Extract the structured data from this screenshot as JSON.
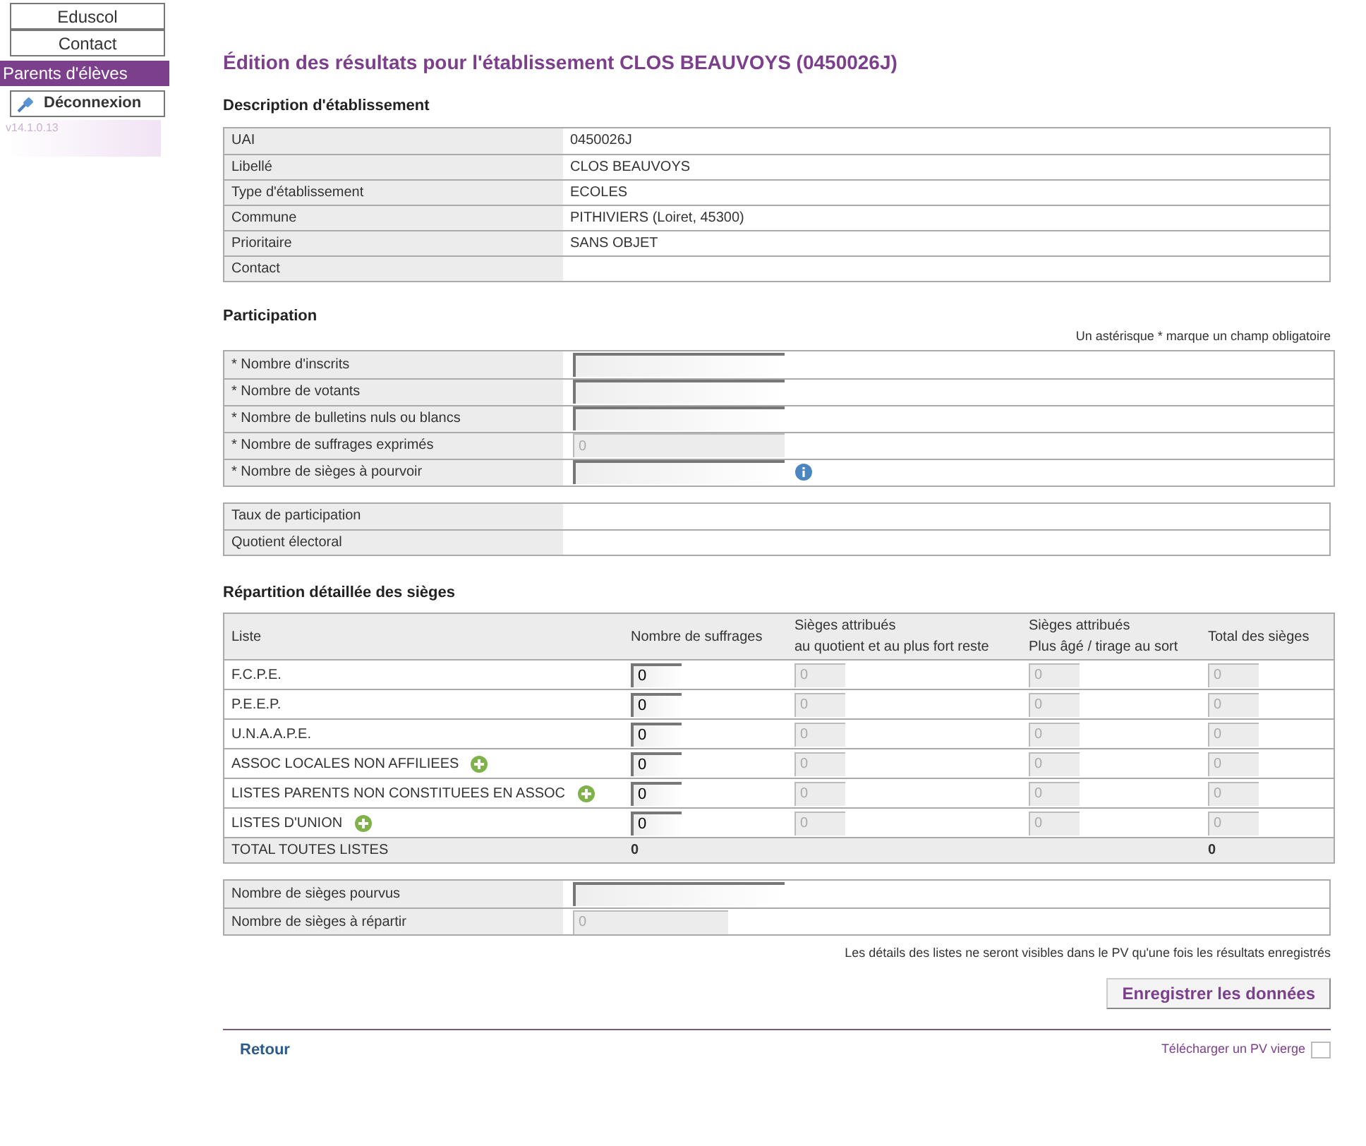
{
  "sidebar": {
    "menu": [
      {
        "label": "Eduscol",
        "selected": false
      },
      {
        "label": "Contact",
        "selected": false
      },
      {
        "label": "Parents d'élèves",
        "selected": true
      }
    ],
    "logout": "Déconnexion",
    "version": "v14.1.0.13"
  },
  "title": "Édition des résultats pour l'établissement CLOS BEAUVOYS (0450026J)",
  "description": {
    "heading": "Description d'établissement",
    "rows": [
      {
        "label": "UAI",
        "value": "0450026J"
      },
      {
        "label": "Libellé",
        "value": "CLOS BEAUVOYS"
      },
      {
        "label": "Type d'établissement",
        "value": "ECOLES"
      },
      {
        "label": "Commune",
        "value": "PITHIVIERS (Loiret, 45300)"
      },
      {
        "label": "Prioritaire",
        "value": "SANS OBJET"
      },
      {
        "label": "Contact"
      }
    ]
  },
  "participation": {
    "heading": "Participation",
    "note": "Un astérisque * marque un champ obligatoire",
    "fields": [
      {
        "label": "* Nombre d'inscrits",
        "disabled": false,
        "info": false
      },
      {
        "label": "* Nombre de votants",
        "disabled": false,
        "info": false
      },
      {
        "label": "* Nombre de bulletins nuls ou blancs",
        "disabled": false,
        "info": false
      },
      {
        "label": "* Nombre de suffrages exprimés",
        "value": "0",
        "disabled": true,
        "info": false
      },
      {
        "label": "* Nombre de sièges à pourvoir",
        "disabled": false,
        "info": true
      }
    ],
    "stats": [
      {
        "label": "Taux de participation"
      },
      {
        "label": "Quotient électoral"
      }
    ]
  },
  "repartition": {
    "heading": "Répartition détaillée des sièges",
    "columns": [
      {
        "lines": [
          "Liste"
        ]
      },
      {
        "lines": [
          "Nombre de suffrages"
        ]
      },
      {
        "lines": [
          "Sièges attribués",
          "au quotient et au plus fort reste"
        ]
      },
      {
        "lines": [
          "Sièges attribués",
          "Plus âgé / tirage au sort"
        ]
      },
      {
        "lines": [
          "Total des sièges"
        ]
      }
    ],
    "rows": [
      {
        "cells": [
          {
            "label": "F.C.P.E.",
            "add": false
          },
          {
            "value": "0",
            "disabled": false
          },
          {
            "value": "0",
            "disabled": true
          },
          {
            "value": "0",
            "disabled": true
          },
          {
            "value": "0",
            "disabled": true
          }
        ]
      },
      {
        "cells": [
          {
            "label": "P.E.E.P.",
            "add": false
          },
          {
            "value": "0",
            "disabled": false
          },
          {
            "value": "0",
            "disabled": true
          },
          {
            "value": "0",
            "disabled": true
          },
          {
            "value": "0",
            "disabled": true
          }
        ]
      },
      {
        "cells": [
          {
            "label": "U.N.A.A.P.E.",
            "add": false
          },
          {
            "value": "0",
            "disabled": false
          },
          {
            "value": "0",
            "disabled": true
          },
          {
            "value": "0",
            "disabled": true
          },
          {
            "value": "0",
            "disabled": true
          }
        ]
      },
      {
        "cells": [
          {
            "label": "ASSOC LOCALES NON AFFILIEES",
            "add": true
          },
          {
            "value": "0",
            "disabled": false
          },
          {
            "value": "0",
            "disabled": true
          },
          {
            "value": "0",
            "disabled": true
          },
          {
            "value": "0",
            "disabled": true
          }
        ]
      },
      {
        "cells": [
          {
            "label": "LISTES PARENTS NON CONSTITUEES EN ASSOC",
            "add": true
          },
          {
            "value": "0",
            "disabled": false
          },
          {
            "value": "0",
            "disabled": true
          },
          {
            "value": "0",
            "disabled": true
          },
          {
            "value": "0",
            "disabled": true
          }
        ]
      },
      {
        "cells": [
          {
            "label": "LISTES D'UNION",
            "add": true
          },
          {
            "value": "0",
            "disabled": false
          },
          {
            "value": "0",
            "disabled": true
          },
          {
            "value": "0",
            "disabled": true
          },
          {
            "value": "0",
            "disabled": true
          }
        ]
      }
    ],
    "total": {
      "label": "TOTAL TOUTES LISTES",
      "votes": "0",
      "seats": "0"
    }
  },
  "seats": [
    {
      "label": "Nombre de sièges pourvus",
      "disabled": false
    },
    {
      "label": "Nombre de sièges à répartir",
      "value": "0",
      "disabled": true
    }
  ],
  "footnote": "Les détails des listes ne seront visibles dans le PV qu'une fois les résultats enregistrés",
  "save_button": "Enregistrer les données",
  "back_link": "Retour",
  "download_link": "Télécharger un PV vierge"
}
